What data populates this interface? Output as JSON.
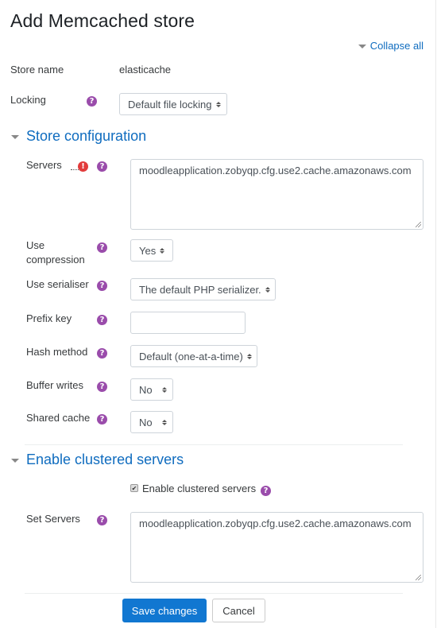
{
  "page": {
    "title": "Add Memcached store",
    "collapse_all": "Collapse all"
  },
  "general": {
    "store_name_label": "Store name",
    "store_name_value": "elasticache",
    "locking_label": "Locking",
    "locking_value": "Default file locking"
  },
  "store_configuration": {
    "heading": "Store configuration",
    "servers_label": "Servers",
    "servers_value": "moodleapplication.zobyqp.cfg.use2.cache.amazonaws.com",
    "compression_label": "Use compression",
    "compression_value": "Yes",
    "serialiser_label": "Use serialiser",
    "serialiser_value": "The default PHP serializer.",
    "prefix_label": "Prefix key",
    "prefix_value": "",
    "hash_label": "Hash method",
    "hash_value": "Default (one-at-a-time)",
    "buffer_label": "Buffer writes",
    "buffer_value": "No",
    "shared_label": "Shared cache",
    "shared_value": "No"
  },
  "clustered": {
    "heading": "Enable clustered servers",
    "checkbox_label": "Enable clustered servers",
    "checkbox_checked": true,
    "set_servers_label": "Set Servers",
    "set_servers_value": "moodleapplication.zobyqp.cfg.use2.cache.amazonaws.com"
  },
  "actions": {
    "save_label": "Save changes",
    "cancel_label": "Cancel"
  },
  "icons": {
    "help": "?",
    "required": "!",
    "check": "✔"
  },
  "colors": {
    "link": "#0f6cbf",
    "help_icon": "#9a4cab",
    "required_icon": "#e23b3b",
    "primary_button": "#1177d1"
  }
}
